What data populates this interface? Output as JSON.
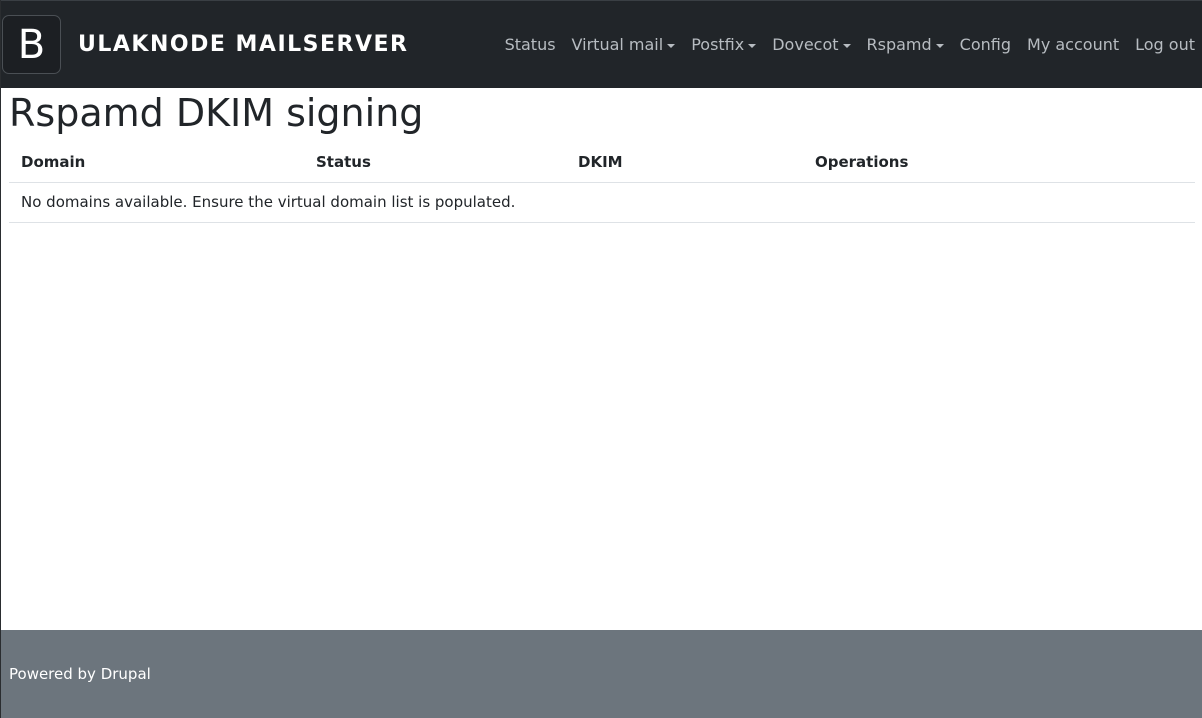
{
  "header": {
    "logo_letter": "B",
    "site_name": "ULAKNODE MAILSERVER",
    "nav": [
      {
        "label": "Status",
        "dropdown": false
      },
      {
        "label": "Virtual mail",
        "dropdown": true
      },
      {
        "label": "Postfix",
        "dropdown": true
      },
      {
        "label": "Dovecot",
        "dropdown": true
      },
      {
        "label": "Rspamd",
        "dropdown": true
      },
      {
        "label": "Config",
        "dropdown": false
      },
      {
        "label": "My account",
        "dropdown": false
      },
      {
        "label": "Log out",
        "dropdown": false
      }
    ]
  },
  "main": {
    "title": "Rspamd DKIM signing",
    "table": {
      "columns": [
        "Domain",
        "Status",
        "DKIM",
        "Operations"
      ],
      "empty_message": "No domains available. Ensure the virtual domain list is populated."
    }
  },
  "footer": {
    "text": "Powered by Drupal"
  },
  "colors": {
    "navbar_bg": "#212529",
    "footer_bg": "#6c757d",
    "nav_text": "#b7bcc1"
  }
}
